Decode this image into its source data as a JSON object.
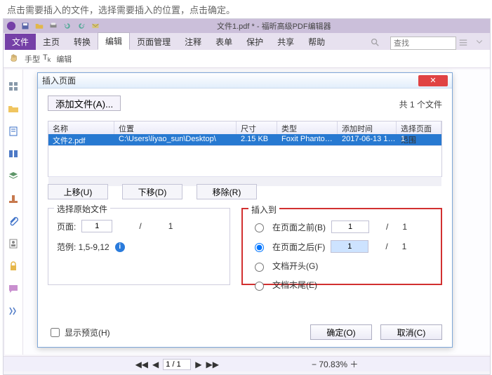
{
  "intro": "点击需要插入的文件，选择需要插入的位置，点击确定。",
  "app": {
    "titlebar": "文件1.pdf * - 福昕高级PDF编辑器",
    "tabs": {
      "file": "文件",
      "home": "主页",
      "convert": "转换",
      "edit": "编辑",
      "page_mgmt": "页面管理",
      "comment": "注释",
      "form": "表单",
      "protect": "保护",
      "share": "共享",
      "help": "帮助"
    },
    "find_placeholder": "查找",
    "tools": {
      "hand": "手型",
      "write": "编辑"
    },
    "status": {
      "page_box": "1 / 1",
      "zoom": "70.83%"
    }
  },
  "modal": {
    "title": "插入页面",
    "add_button": "添加文件(A)...",
    "file_count": "共 1 个文件",
    "grid": {
      "headers": {
        "name": "名称",
        "location": "位置",
        "size": "尺寸",
        "type": "类型",
        "time": "添加时间",
        "range": "选择页面范围"
      },
      "row": {
        "name": "文件2.pdf",
        "location": "C:\\Users\\liyao_sun\\Desktop\\",
        "size": "2.15 KB",
        "type": "Foxit Phanto…",
        "time": "2017-06-13 1…",
        "range": "1"
      }
    },
    "btns": {
      "up": "上移(U)",
      "down": "下移(D)",
      "remove": "移除(R)"
    },
    "source": {
      "label": "选择原始文件",
      "page": "页面:",
      "page_val": "1",
      "slash": "/",
      "total": "1",
      "range_label": "范例: 1,5-9,12"
    },
    "insert": {
      "label": "插入到",
      "before": "在页面之前(B)",
      "after": "在页面之后(F)",
      "begin": "文档开头(G)",
      "end": "文档末尾(E)",
      "before_val": "1",
      "before_total": "1",
      "after_val": "1",
      "after_total": "1",
      "slash": "/"
    },
    "preview_chk": "显示预览(H)",
    "ok": "确定(O)",
    "cancel": "取消(C)"
  }
}
